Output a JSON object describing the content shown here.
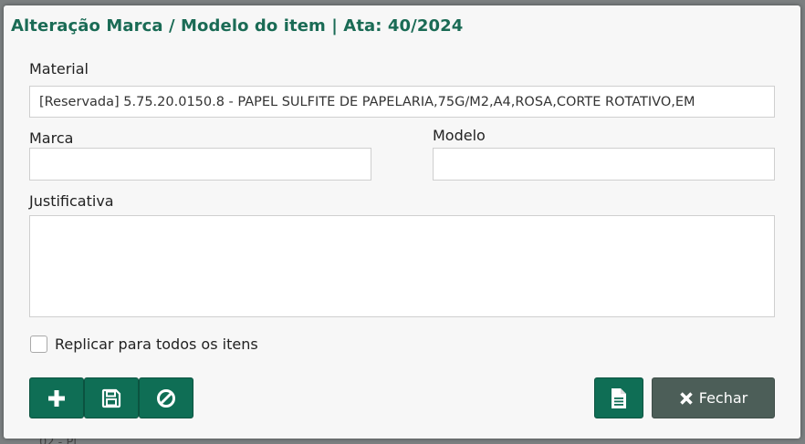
{
  "backdrop": {
    "text": "…02 - Pl…"
  },
  "dialog": {
    "title": "Alteração Marca / Modelo do item | Ata: 40/2024",
    "material": {
      "label": "Material",
      "value": "[Reservada] 5.75.20.0150.8 - PAPEL SULFITE DE PAPELARIA,75G/M2,A4,ROSA,CORTE ROTATIVO,EM"
    },
    "marca": {
      "label": "Marca",
      "value": ""
    },
    "modelo": {
      "label": "Modelo",
      "value": ""
    },
    "justificativa": {
      "label": "Justificativa",
      "value": ""
    },
    "replicar": {
      "label": "Replicar para todos os itens",
      "checked": false
    },
    "buttons": {
      "add_icon": "plus-icon",
      "save_icon": "floppy-icon",
      "cancel_icon": "ban-icon",
      "report_icon": "document-icon",
      "close_label": "Fechar",
      "close_icon": "x-icon"
    },
    "colors": {
      "title": "#1a6b55",
      "primary": "#0f6e55",
      "close_button": "#4c5e58"
    }
  }
}
